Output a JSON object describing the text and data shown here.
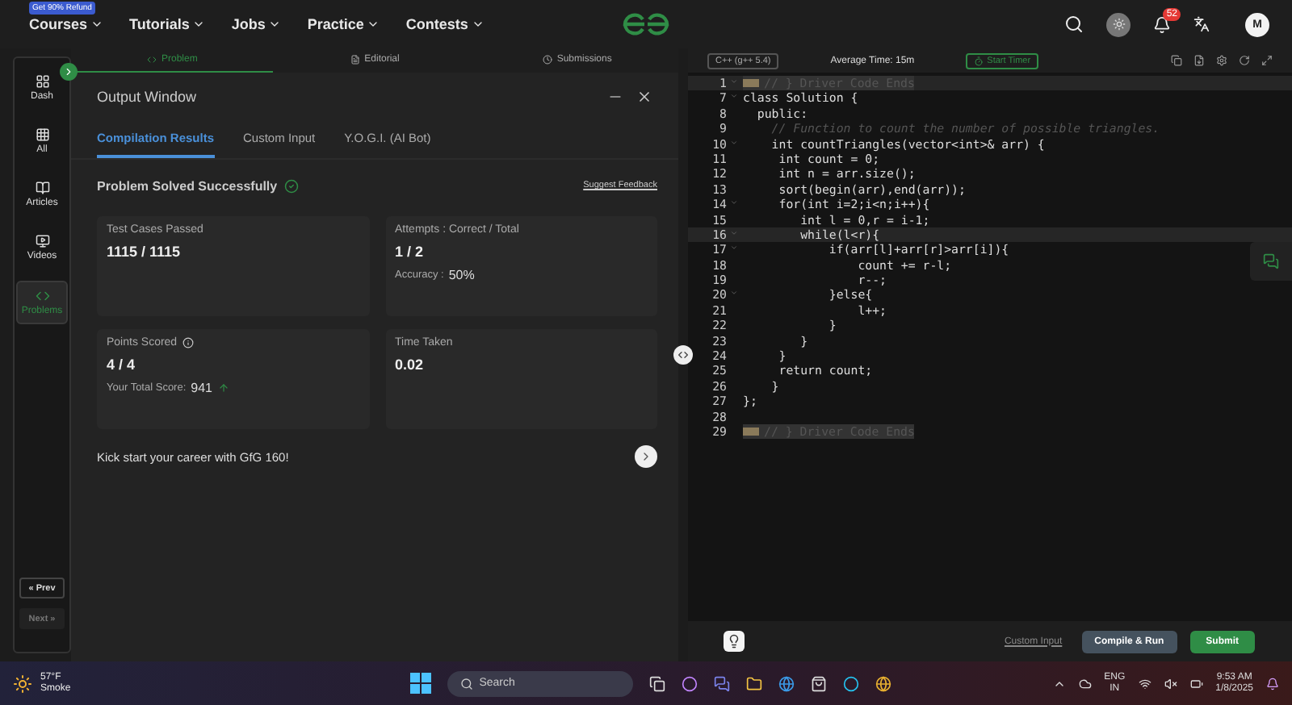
{
  "nav": {
    "promo_badge": "Get 90% Refund",
    "items": [
      "Courses",
      "Tutorials",
      "Jobs",
      "Practice",
      "Contests"
    ],
    "notification_count": "52",
    "avatar_initial": "M"
  },
  "sidebar": {
    "items": [
      {
        "label": "Dash",
        "kind": "dash",
        "selected": false
      },
      {
        "label": "All",
        "kind": "all",
        "selected": false
      },
      {
        "label": "Articles",
        "kind": "articles",
        "selected": false
      },
      {
        "label": "Videos",
        "kind": "videos",
        "selected": false
      },
      {
        "label": "Problems",
        "kind": "problems",
        "selected": true
      }
    ],
    "prev": {
      "label": "« Prev",
      "disabled": false
    },
    "next": {
      "label": "Next »",
      "disabled": true
    }
  },
  "problem_tabs": [
    {
      "label": "Problem",
      "kind": "problem",
      "selected": true
    },
    {
      "label": "Editorial",
      "kind": "editorial",
      "selected": false
    },
    {
      "label": "Submissions",
      "kind": "submissions",
      "selected": false
    }
  ],
  "output_window": {
    "title": "Output Window",
    "tabs": [
      {
        "label": "Compilation Results",
        "selected": true
      },
      {
        "label": "Custom Input",
        "selected": false
      },
      {
        "label": "Y.O.G.I. (AI Bot)",
        "selected": false
      }
    ],
    "status": "Problem Solved Successfully",
    "feedback_link": "Suggest Feedback",
    "cards": [
      {
        "label": "Test Cases Passed",
        "value": "1115 / 1115",
        "info": false
      },
      {
        "label": "Attempts : Correct / Total",
        "value": "1 / 2",
        "sub_label": "Accuracy :",
        "sub_value": "50%",
        "info": false
      },
      {
        "label": "Points Scored",
        "value": "4 / 4",
        "sub_label": "Your Total Score:",
        "sub_value": "941",
        "rising": true,
        "info": true
      },
      {
        "label": "Time Taken",
        "value": "0.02",
        "info": false
      }
    ],
    "promo": "Kick start your career with GfG 160!"
  },
  "editor": {
    "language": "C++ (g++ 5.4)",
    "average_time": "Average Time: 15m",
    "timer_button": "Start Timer",
    "lines": [
      {
        "number": "1",
        "kind": "folded",
        "text": "// } Driver Code Ends",
        "foldable": true,
        "current": true
      },
      {
        "number": "7",
        "kind": "code",
        "text": "class Solution {",
        "foldable": true,
        "current": false
      },
      {
        "number": "8",
        "kind": "code",
        "text": "  public:",
        "foldable": false,
        "current": false
      },
      {
        "number": "9",
        "kind": "comment",
        "text": "    // Function to count the number of possible triangles.",
        "foldable": false,
        "current": false
      },
      {
        "number": "10",
        "kind": "code",
        "text": "    int countTriangles(vector<int>& arr) {",
        "foldable": true,
        "current": false
      },
      {
        "number": "11",
        "kind": "code",
        "text": "     int count = 0;",
        "foldable": false,
        "current": false
      },
      {
        "number": "12",
        "kind": "code",
        "text": "     int n = arr.size();",
        "foldable": false,
        "current": false
      },
      {
        "number": "13",
        "kind": "code",
        "text": "     sort(begin(arr),end(arr));",
        "foldable": false,
        "current": false
      },
      {
        "number": "14",
        "kind": "code",
        "text": "     for(int i=2;i<n;i++){",
        "foldable": true,
        "current": false
      },
      {
        "number": "15",
        "kind": "code",
        "text": "        int l = 0,r = i-1;",
        "foldable": false,
        "current": false
      },
      {
        "number": "16",
        "kind": "code",
        "text": "        while(l<r){",
        "foldable": true,
        "current": true
      },
      {
        "number": "17",
        "kind": "code",
        "text": "            if(arr[l]+arr[r]>arr[i]){",
        "foldable": true,
        "current": false
      },
      {
        "number": "18",
        "kind": "code",
        "text": "                count += r-l;",
        "foldable": false,
        "current": false
      },
      {
        "number": "19",
        "kind": "code",
        "text": "                r--;",
        "foldable": false,
        "current": false
      },
      {
        "number": "20",
        "kind": "code",
        "text": "            }else{",
        "foldable": true,
        "current": false
      },
      {
        "number": "21",
        "kind": "code",
        "text": "                l++;",
        "foldable": false,
        "current": false
      },
      {
        "number": "22",
        "kind": "code",
        "text": "            }",
        "foldable": false,
        "current": false
      },
      {
        "number": "23",
        "kind": "code",
        "text": "        }",
        "foldable": false,
        "current": false
      },
      {
        "number": "24",
        "kind": "code",
        "text": "     }",
        "foldable": false,
        "current": false
      },
      {
        "number": "25",
        "kind": "code",
        "text": "     return count;",
        "foldable": false,
        "current": false
      },
      {
        "number": "26",
        "kind": "code",
        "text": "    }",
        "foldable": false,
        "current": false
      },
      {
        "number": "27",
        "kind": "code",
        "text": "};",
        "foldable": false,
        "current": false
      },
      {
        "number": "28",
        "kind": "code",
        "foldable": false,
        "current": false
      },
      {
        "number": "29",
        "kind": "folded",
        "text": "// } Driver Code Ends",
        "foldable": false,
        "current": false
      }
    ],
    "custom_input_link": "Custom Input",
    "compile_button": "Compile & Run",
    "submit_button": "Submit"
  },
  "taskbar": {
    "temperature": "57°F",
    "weather": "Smoke",
    "search_placeholder": "Search",
    "language": "ENG",
    "region": "IN",
    "time": "9:53 AM",
    "date": "1/8/2025"
  }
}
